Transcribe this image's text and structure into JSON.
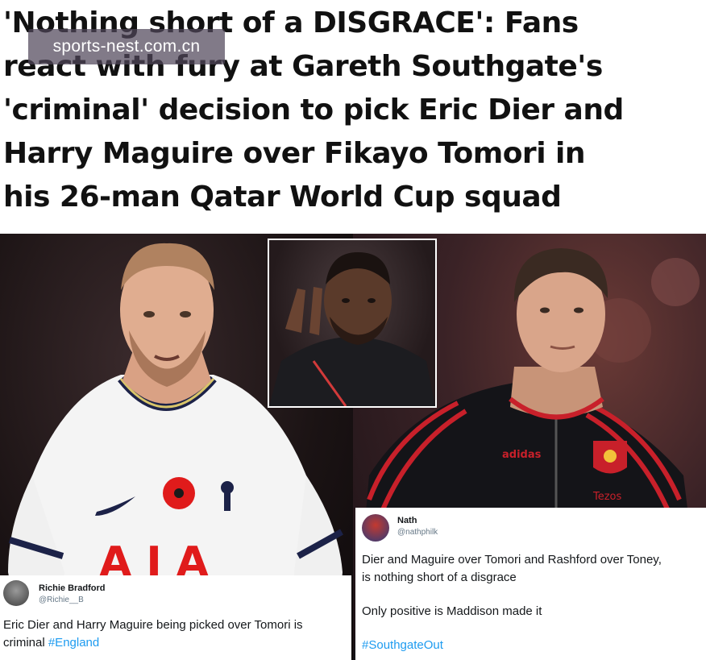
{
  "headline": {
    "lines": [
      "'Nothing short of a DISGRACE': Fans",
      "react with fury at Gareth Southgate's",
      "'criminal' decision to pick Eric Dier and",
      "Harry Maguire over Fikayo Tomori in",
      "his 26-man Qatar World Cup squad"
    ]
  },
  "watermark": "sports-nest.com.cn",
  "photos": {
    "left_shirt": {
      "sponsor": "AIA"
    },
    "right_jacket": {
      "brand": "adidas",
      "sponsor": "Tezos"
    }
  },
  "tweets": [
    {
      "name": "Richie Bradford",
      "handle": "@Richie__B",
      "text_lines": [
        "Eric Dier and Harry Maguire being picked over Tomori is",
        "criminal "
      ],
      "hashtag": "#England"
    },
    {
      "name": "Nath",
      "handle": "@nathphilk",
      "text_lines": [
        "Dier and Maguire over Tomori and Rashford over Toney,",
        "is nothing short of a disgrace",
        "Only positive is Maddison made it"
      ],
      "hashtag": "#SouthgateOut"
    }
  ],
  "colors": {
    "hashtag": "#1d9bf0",
    "watermark_bg": "#504656"
  }
}
